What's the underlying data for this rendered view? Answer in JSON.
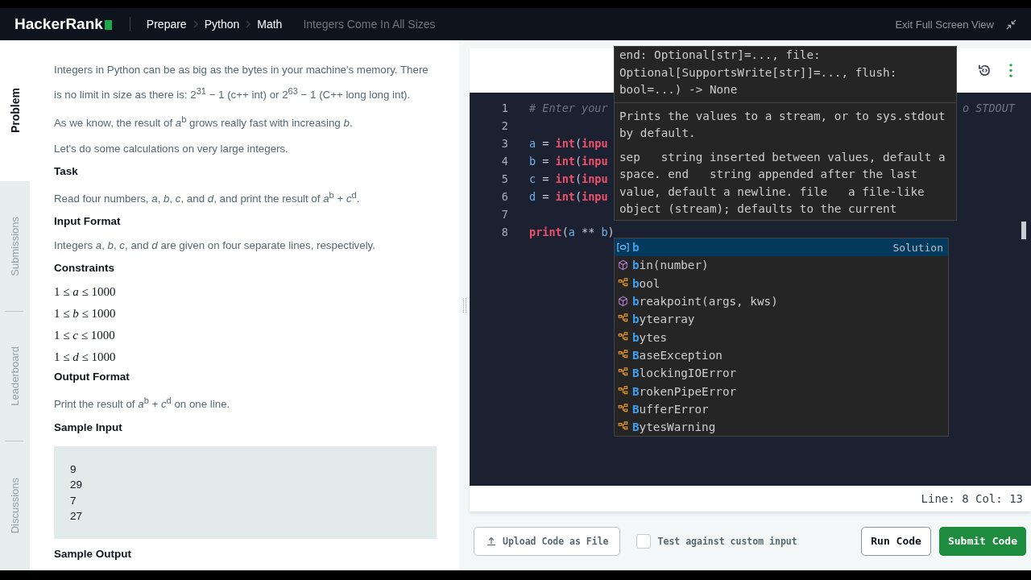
{
  "header": {
    "logo": "HackerRank",
    "breadcrumbs": [
      {
        "label": "Prepare",
        "current": false
      },
      {
        "label": "Python",
        "current": false
      },
      {
        "label": "Math",
        "current": false
      },
      {
        "label": "Integers Come In All Sizes",
        "current": true
      }
    ],
    "exit_label": "Exit Full Screen View"
  },
  "side_tabs": [
    {
      "label": "Problem",
      "selected": true
    },
    {
      "label": "Submissions",
      "selected": false
    },
    {
      "label": "Leaderboard",
      "selected": false
    },
    {
      "label": "Discussions",
      "selected": false
    }
  ],
  "problem": [
    {
      "kind": "para",
      "text": "Integers in Python can be as big as the bytes in your machine's memory. There is no limit in size as there is: 2$^{31}$ − 1 (c++ int) or 2$^{63}$ − 1 (C++ long long int)."
    },
    {
      "kind": "para",
      "text": "As we know, the result of *a*$^{b}$ grows really fast with increasing *b*."
    },
    {
      "kind": "para",
      "text": "Let's do some calculations on very large integers."
    },
    {
      "kind": "heading",
      "text": "Task"
    },
    {
      "kind": "para",
      "text": "Read four numbers, *a*, *b*, *c*, and *d*, and print the result of *a*$^{b}$ + *c*$^{d}$."
    },
    {
      "kind": "heading",
      "text": "Input Format"
    },
    {
      "kind": "para",
      "text": "Integers *a*, *b*, *c*, and *d* are given on four separate lines, respectively."
    },
    {
      "kind": "heading",
      "text": "Constraints"
    },
    {
      "kind": "math",
      "text": "1 ≤ *a* ≤ 1000"
    },
    {
      "kind": "math",
      "text": "1 ≤ *b* ≤ 1000"
    },
    {
      "kind": "math",
      "text": "1 ≤ *c* ≤ 1000"
    },
    {
      "kind": "math",
      "text": "1 ≤ *d* ≤ 1000"
    },
    {
      "kind": "heading",
      "text": "Output Format"
    },
    {
      "kind": "para",
      "text": "Print the result of *a*$^{b}$ + *c*$^{d}$ on one line."
    },
    {
      "kind": "heading",
      "text": "Sample Input"
    },
    {
      "kind": "code",
      "lines": [
        "9",
        "29",
        "7",
        "27"
      ]
    },
    {
      "kind": "heading",
      "text": "Sample Output"
    }
  ],
  "editor": {
    "lines": [
      {
        "number": "1",
        "tokens": [
          {
            "text": "# Enter your",
            "kind": "comment"
          }
        ],
        "tail": "o STDOUT"
      },
      {
        "number": "2"
      },
      {
        "number": "3",
        "tokens": [
          {
            "text": "a",
            "kind": "var"
          },
          {
            "text": " = ",
            "kind": "op"
          },
          {
            "text": "int",
            "kind": "fn"
          },
          {
            "text": "(",
            "kind": "op"
          },
          {
            "text": "inpu",
            "kind": "fn"
          }
        ]
      },
      {
        "number": "4",
        "tokens": [
          {
            "text": "b",
            "kind": "var"
          },
          {
            "text": " = ",
            "kind": "op"
          },
          {
            "text": "int",
            "kind": "fn"
          },
          {
            "text": "(",
            "kind": "op"
          },
          {
            "text": "inpu",
            "kind": "fn"
          }
        ]
      },
      {
        "number": "5",
        "tokens": [
          {
            "text": "c",
            "kind": "var"
          },
          {
            "text": " = ",
            "kind": "op"
          },
          {
            "text": "int",
            "kind": "fn"
          },
          {
            "text": "(",
            "kind": "op"
          },
          {
            "text": "inpu",
            "kind": "fn"
          }
        ]
      },
      {
        "number": "6",
        "tokens": [
          {
            "text": "d",
            "kind": "var"
          },
          {
            "text": " = ",
            "kind": "op"
          },
          {
            "text": "int",
            "kind": "fn"
          },
          {
            "text": "(",
            "kind": "op"
          },
          {
            "text": "inpu",
            "kind": "fn"
          }
        ]
      },
      {
        "number": "7"
      },
      {
        "number": "8",
        "tokens": [
          {
            "text": "print",
            "kind": "fn"
          },
          {
            "text": "(",
            "kind": "op"
          },
          {
            "text": "a",
            "kind": "var"
          },
          {
            "text": " ** ",
            "kind": "op"
          },
          {
            "text": "b",
            "kind": "var"
          },
          {
            "text": ")",
            "kind": "op"
          }
        ]
      }
    ],
    "tooltip": {
      "signature": "end: Optional[str]=..., file: Optional[SupportsWrite[str]]=..., flush: bool=...) -> None",
      "description": "Prints the values to a stream, or to sys.stdout by default.",
      "params": "sep   string inserted between values, default a space. end   string appended after the last value, default a newline. file   a file-like object (stream); defaults to the current"
    },
    "suggestions": [
      {
        "kind": "variable",
        "match": "b",
        "detail": "Solution",
        "selected": true
      },
      {
        "kind": "method",
        "match": "b",
        "rest": "in(number)",
        "selected": false
      },
      {
        "kind": "class",
        "match": "b",
        "rest": "ool",
        "selected": false
      },
      {
        "kind": "method",
        "match": "b",
        "rest": "reakpoint(args, kws)",
        "selected": false
      },
      {
        "kind": "class",
        "match": "b",
        "rest": "ytearray",
        "selected": false
      },
      {
        "kind": "class",
        "match": "b",
        "rest": "ytes",
        "selected": false
      },
      {
        "kind": "class",
        "match": "B",
        "rest": "aseException",
        "selected": false
      },
      {
        "kind": "class",
        "match": "B",
        "rest": "lockingIOError",
        "selected": false
      },
      {
        "kind": "class",
        "match": "B",
        "rest": "rokenPipeError",
        "selected": false
      },
      {
        "kind": "class",
        "match": "B",
        "rest": "ufferError",
        "selected": false
      },
      {
        "kind": "class",
        "match": "B",
        "rest": "ytesWarning",
        "selected": false
      }
    ],
    "status": "Line: 8 Col: 13"
  },
  "footer": {
    "upload_label": "Upload Code as File",
    "custom_input": {
      "label": "Test against custom input",
      "checked": false
    },
    "run_label": "Run Code",
    "submit_label": "Submit Code"
  }
}
